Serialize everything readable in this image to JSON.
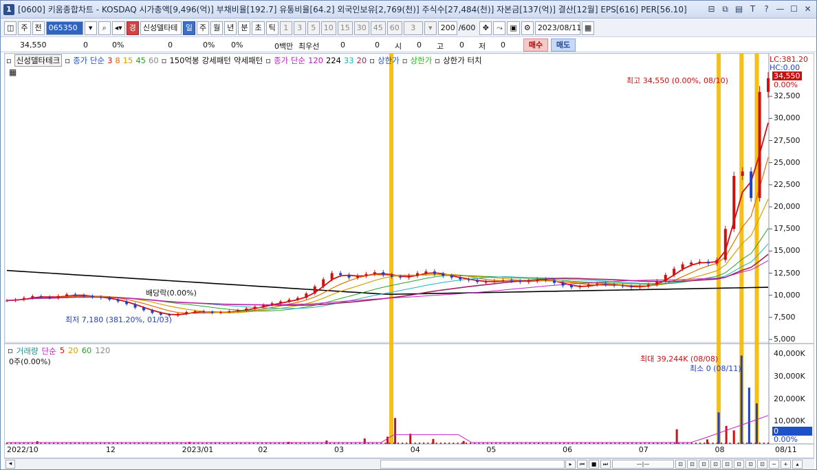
{
  "window": {
    "number": "1",
    "title": "[0600] 키움종합차트 - KOSDAQ 시가총액[9,496(억)] 부채비율[192.7] 유통비율[64.2] 외국인보유[2,769(천)] 주식수[27,484(천)] 자본금[137(억)] 결산[12월] EPS[616] PER[56.10]",
    "controls": [
      "⊟",
      "⧉",
      "▤",
      "T",
      "?",
      "—",
      "☐",
      "✕"
    ]
  },
  "toolbar": {
    "mode": "주",
    "prev": "전",
    "code": "065350",
    "stock_name": "신성델타테",
    "periods": [
      "일",
      "주",
      "월",
      "년",
      "분",
      "초",
      "틱"
    ],
    "active_period": "일",
    "intervals": [
      "1",
      "3",
      "5",
      "10",
      "15",
      "30",
      "45",
      "60"
    ],
    "interval_select": "3",
    "count": "200",
    "count_total": "/600",
    "date": "2023/08/11"
  },
  "quote": {
    "price": "34,550",
    "change": "0",
    "change_pct": "0%",
    "val2": "0",
    "val2_pct": "0%",
    "val3": "0%",
    "amount": "0백만",
    "priority": "최우선",
    "bid": "0",
    "ask": "0",
    "open_label": "시",
    "open": "0",
    "high_label": "고",
    "high": "0",
    "low_label": "저",
    "low": "0",
    "buy": "매수",
    "sell": "매도"
  },
  "legend": {
    "stock": "신성델타테크",
    "ma_label": "종가 단순",
    "ma_periods": [
      "3",
      "8",
      "15",
      "45",
      "60"
    ],
    "ma_colors": [
      "#d01010",
      "#e07000",
      "#d4a000",
      "#2ca02c",
      "#888888"
    ],
    "pattern1": "150억봉",
    "pattern2": "강세패턴",
    "pattern3": "약세패턴",
    "ma2_label": "종가 단순",
    "ma2_periods": [
      "120",
      "224",
      "33",
      "20"
    ],
    "ma2_colors": [
      "#c020c0",
      "#000000",
      "#20b0c0",
      "#a02060"
    ],
    "upper1": "상한가",
    "upper2": "상한가",
    "upper_touch": "상한가 터치"
  },
  "price_axis": {
    "labels": [
      "32,500",
      "30,000",
      "27,500",
      "25,000",
      "22,500",
      "20,000",
      "17,500",
      "15,000",
      "12,500",
      "10,000",
      "7,500",
      "5,000"
    ],
    "lc": "LC:381.20",
    "hc": "HC:0.00",
    "last_price": "34,550",
    "last_pct": "0.00%"
  },
  "volume_axis": {
    "labels": [
      "40,000K",
      "30,000K",
      "20,000K",
      "10,000K"
    ],
    "last": "0",
    "last_pct": "0.00%"
  },
  "annotations": {
    "high": "최고 34,550 (0.00%, 08/10)",
    "low": "최저 7,180 (381.20%, 01/03)",
    "dividend": "배당락(0.00%)",
    "vol_max": "최대 39,244K (08/08)",
    "vol_min": "최소 0 (08/11)"
  },
  "volume_legend": {
    "label": "거래량",
    "ma": "단순",
    "periods": [
      "5",
      "20",
      "60",
      "120"
    ],
    "colors": [
      "#d01010",
      "#d4a000",
      "#2ca02c",
      "#888888"
    ],
    "sub": "0주(0.00%)"
  },
  "date_axis": [
    "2022/10",
    "12",
    "2023/01",
    "02",
    "03",
    "04",
    "05",
    "06",
    "07",
    "08",
    "08/11"
  ],
  "chart_data": {
    "type": "candlestick",
    "price_range": [
      5000,
      35000
    ],
    "price_series": [
      9400,
      9500,
      9700,
      9900,
      9800,
      9700,
      9900,
      10100,
      10000,
      9900,
      9800,
      9700,
      9500,
      9300,
      9000,
      8600,
      8300,
      8000,
      7800,
      7700,
      7900,
      8100,
      8200,
      8100,
      8000,
      8100,
      8200,
      8300,
      8500,
      8700,
      8900,
      9100,
      9300,
      9500,
      9700,
      10200,
      11000,
      11800,
      12500,
      12300,
      12000,
      12200,
      12400,
      12600,
      12300,
      12100,
      12000,
      12200,
      12500,
      12700,
      12400,
      12200,
      12000,
      11800,
      11700,
      11500,
      11500,
      11600,
      11700,
      11600,
      11500,
      11600,
      11800,
      11700,
      11400,
      11100,
      10900,
      11000,
      11200,
      11300,
      11200,
      11100,
      11000,
      10900,
      11000,
      11200,
      11600,
      12300,
      13000,
      13500,
      13700,
      13800,
      13600,
      14000,
      17500,
      23500,
      24000,
      21000,
      33000,
      34550
    ],
    "volume_max_k": 40000,
    "volume_spikes_k": [
      {
        "x": 0.04,
        "v": 1200
      },
      {
        "x": 0.24,
        "v": 900
      },
      {
        "x": 0.37,
        "v": 900
      },
      {
        "x": 0.42,
        "v": 1500
      },
      {
        "x": 0.47,
        "v": 2400
      },
      {
        "x": 0.5,
        "v": 3200
      },
      {
        "x": 0.51,
        "v": 11500
      },
      {
        "x": 0.53,
        "v": 4500
      },
      {
        "x": 0.56,
        "v": 2200
      },
      {
        "x": 0.6,
        "v": 1300
      },
      {
        "x": 0.88,
        "v": 6500
      },
      {
        "x": 0.92,
        "v": 2000
      },
      {
        "x": 0.935,
        "v": 14000
      },
      {
        "x": 0.945,
        "v": 8000
      },
      {
        "x": 0.955,
        "v": 6000
      },
      {
        "x": 0.965,
        "v": 39244
      },
      {
        "x": 0.975,
        "v": 25000
      },
      {
        "x": 0.985,
        "v": 18000
      }
    ],
    "highlight_bars_x": [
      0.505,
      0.935,
      0.965,
      0.985
    ]
  }
}
